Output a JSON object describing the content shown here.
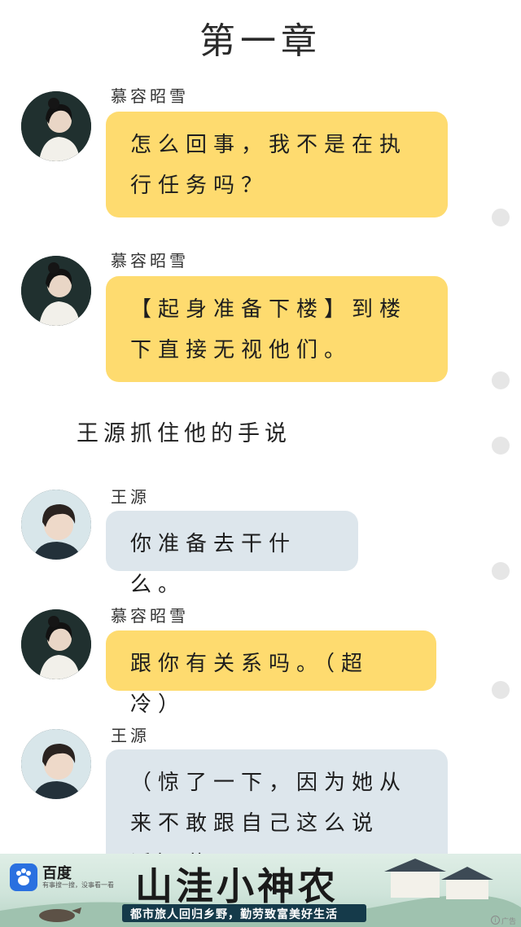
{
  "chapter": {
    "title": "第一章"
  },
  "messages": [
    {
      "sender": "慕容昭雪",
      "text": "怎么回事，我不是在执行任务吗？",
      "style": "yellow"
    },
    {
      "sender": "慕容昭雪",
      "text": "【起身准备下楼】到楼下直接无视他们。",
      "style": "yellow"
    },
    {
      "sender": "王源",
      "text": "你准备去干什么。",
      "style": "blue"
    },
    {
      "sender": "慕容昭雪",
      "text": "跟你有关系吗。（超冷）",
      "style": "yellow"
    },
    {
      "sender": "王源",
      "text": "（惊了一下，因为她从来不敢跟自己这么说话）慕",
      "style": "blue"
    }
  ],
  "narration": {
    "text": "王源抓住他的手说"
  },
  "ad": {
    "brand": "百度",
    "slogan": "有事搜一搜，没事看一看",
    "title": "山洼小神农",
    "tagline": "都市旅人回归乡野，勤劳致富美好生活",
    "label": "广告"
  },
  "colors": {
    "yellow_bubble": "#fedb6f",
    "blue_bubble": "#dde6ec",
    "side_dot": "#e6e6e6"
  }
}
